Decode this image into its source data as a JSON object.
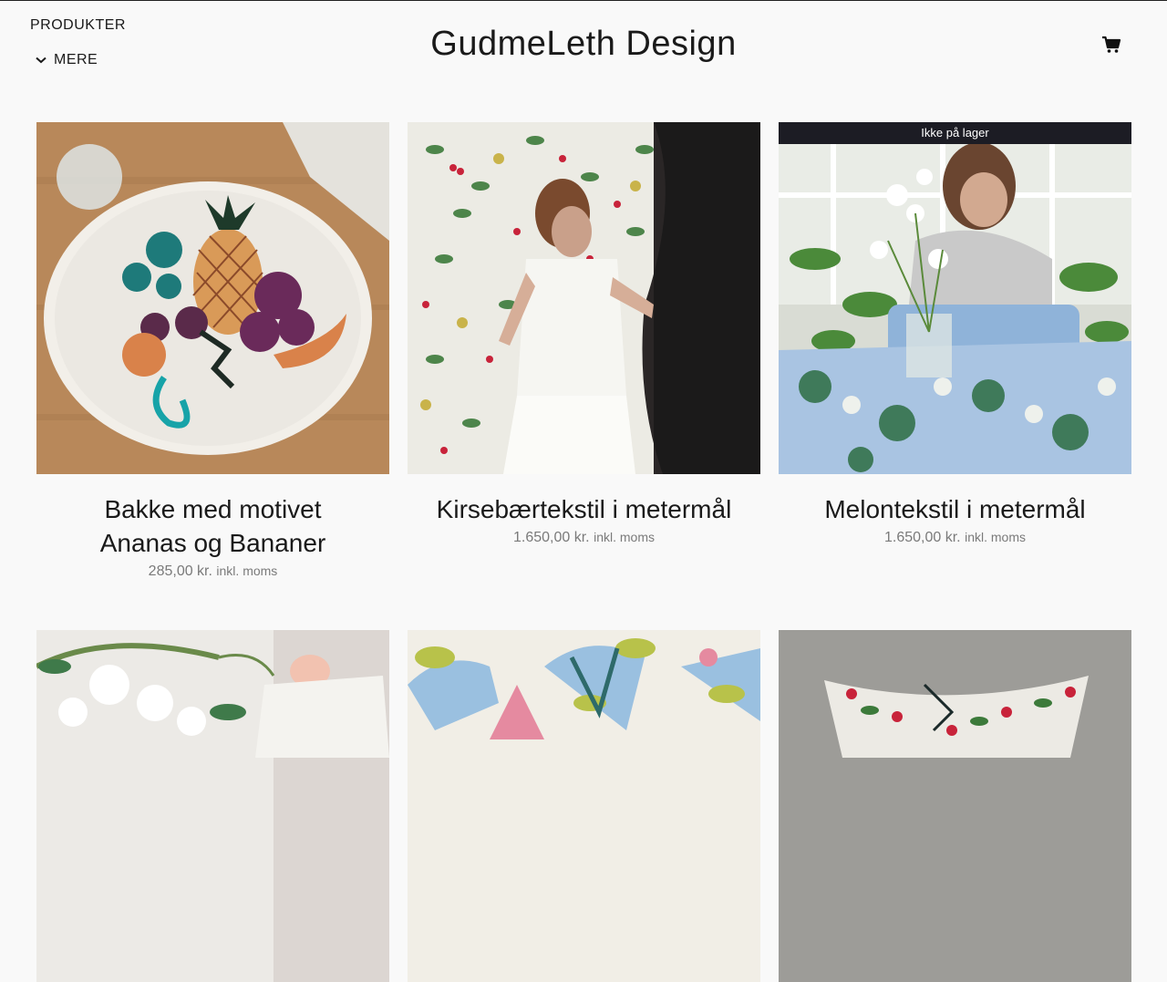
{
  "nav": {
    "products_label": "PRODUKTER",
    "more_label": "MERE"
  },
  "brand": {
    "name": "GudmeLeth Design"
  },
  "cart": {
    "icon": "shopping-cart-icon"
  },
  "products": [
    {
      "title": "Bakke med motivet Ananas og Bananer",
      "price": "285,00 kr.",
      "tax": "inkl. moms",
      "badge": ""
    },
    {
      "title": "Kirsebærtekstil i metermål",
      "price": "1.650,00 kr.",
      "tax": "inkl. moms",
      "badge": ""
    },
    {
      "title": "Melontekstil i metermål",
      "price": "1.650,00 kr.",
      "tax": "inkl. moms",
      "badge": "Ikke på lager"
    },
    {
      "title": "",
      "price": "",
      "tax": "",
      "badge": ""
    },
    {
      "title": "",
      "price": "",
      "tax": "",
      "badge": ""
    },
    {
      "title": "",
      "price": "",
      "tax": "",
      "badge": ""
    }
  ]
}
